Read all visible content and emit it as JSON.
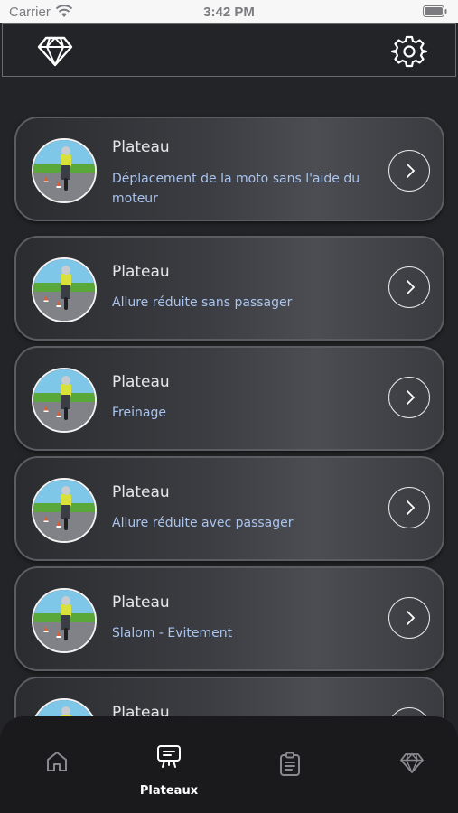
{
  "status_bar": {
    "carrier": "Carrier",
    "time": "3:42 PM"
  },
  "header": {
    "left_icon": "diamond-icon",
    "right_icon": "gear-icon"
  },
  "plateaux": [
    {
      "title": "Plateau",
      "subtitle": "Déplacement de la moto sans l'aide du moteur"
    },
    {
      "title": "Plateau",
      "subtitle": "Allure réduite sans passager"
    },
    {
      "title": "Plateau",
      "subtitle": "Freinage"
    },
    {
      "title": "Plateau",
      "subtitle": "Allure réduite avec passager"
    },
    {
      "title": "Plateau",
      "subtitle": "Slalom - Evitement"
    },
    {
      "title": "Plateau",
      "subtitle": ""
    }
  ],
  "tab_bar": {
    "tabs": [
      {
        "icon": "home-icon",
        "label": ""
      },
      {
        "icon": "presentation-icon",
        "label": "Plateaux",
        "active": true
      },
      {
        "icon": "clipboard-icon",
        "label": ""
      },
      {
        "icon": "diamond-icon",
        "label": ""
      }
    ]
  },
  "colors": {
    "background": "#232427",
    "subtitle": "#a9c4ee",
    "tab_bar": "#1a1a1c",
    "active_tab": "#ffffff",
    "inactive_tab": "#8a8a8e"
  }
}
